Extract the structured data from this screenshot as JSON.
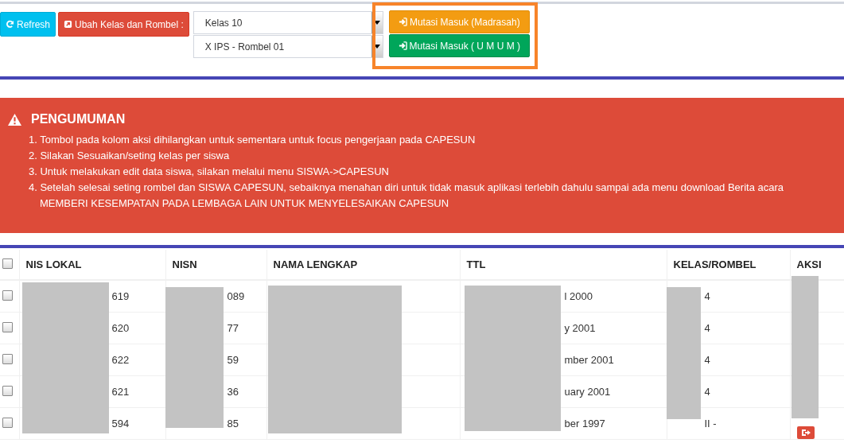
{
  "toolbar": {
    "refresh_button": "Refresh",
    "change_class_button": "Ubah Kelas dan Rombel :",
    "class_select": "Kelas 10",
    "rombel_select": "X IPS - Rombel 01",
    "transfer_buttons": [
      {
        "label": "Mutasi Masuk (Madrasah)",
        "kind": "madrasah"
      },
      {
        "label": "Mutasi Masuk ( U M U M )",
        "kind": "umum"
      }
    ]
  },
  "announcement": {
    "title": "PENGUMUMAN",
    "items": [
      "1. Tombol pada kolom aksi dihilangkan untuk sementara untuk focus pengerjaan pada CAPESUN",
      "2. Silakan Sesuaikan/seting kelas per siswa",
      "3. Untuk melakukan edit data siswa, silakan melalui menu SISWA->CAPESUN",
      "4. Setelah selesai seting rombel dan SISWA CAPESUN, sebaiknya menahan diri untuk tidak masuk aplikasi terlebih dahulu sampai ada menu download Berita acara"
    ],
    "footer": "MEMBERI KESEMPATAN PADA LEMBAGA LAIN UNTUK MENYELESAIKAN CAPESUN"
  },
  "table": {
    "select_all_checked": false,
    "columns": [
      "NIS LOKAL",
      "NISN",
      "NAMA LENGKAP",
      "TTL",
      "KELAS/ROMBEL",
      "AKSI"
    ],
    "rows": [
      {
        "checked": false,
        "nis_lokal": "619",
        "nisn": "089",
        "ttl": "l 2000",
        "kelas_rombel": "4",
        "action": false
      },
      {
        "checked": false,
        "nis_lokal": "620",
        "nisn": "77",
        "ttl": "y 2001",
        "kelas_rombel": "4",
        "action": false
      },
      {
        "checked": false,
        "nis_lokal": "622",
        "nisn": "59",
        "ttl": "mber 2001",
        "kelas_rombel": "4",
        "action": false
      },
      {
        "checked": false,
        "nis_lokal": "621",
        "nisn": "36",
        "ttl": "uary 2001",
        "kelas_rombel": "4",
        "action": false
      },
      {
        "checked": false,
        "nis_lokal": "594",
        "nisn": "85",
        "ttl": "ber 1997",
        "kelas_rombel": "II -",
        "action": true
      }
    ]
  }
}
